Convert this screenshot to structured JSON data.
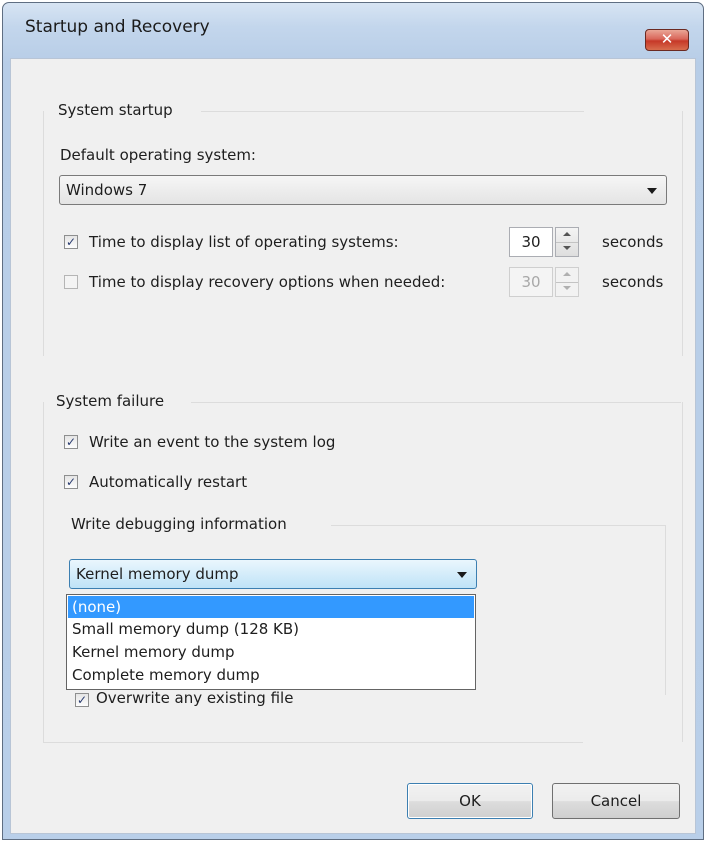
{
  "window": {
    "title": "Startup and Recovery",
    "close_glyph": "✕"
  },
  "system_startup": {
    "group_label": "System startup",
    "default_os_label": "Default operating system:",
    "default_os_value": "Windows 7",
    "list_time": {
      "checked": true,
      "label": "Time to display list of operating systems:",
      "value": "30",
      "unit": "seconds"
    },
    "recovery_time": {
      "checked": false,
      "enabled": false,
      "label": "Time to display recovery options when needed:",
      "value": "30",
      "unit": "seconds"
    }
  },
  "system_failure": {
    "group_label": "System failure",
    "write_event": {
      "checked": true,
      "label": "Write an event to the system log"
    },
    "auto_restart": {
      "checked": true,
      "label": "Automatically restart"
    },
    "debug_group_label": "Write debugging information",
    "debug_selected": "Kernel memory dump",
    "debug_options": [
      "(none)",
      "Small memory dump (128 KB)",
      "Kernel memory dump",
      "Complete memory dump"
    ],
    "highlighted_option": "(none)",
    "overwrite": {
      "checked": true,
      "label": "Overwrite any existing file"
    }
  },
  "buttons": {
    "ok": "OK",
    "cancel": "Cancel"
  },
  "check_glyph": "✓",
  "icons": [
    "close-icon",
    "dropdown-arrow-icon",
    "spin-up-icon",
    "spin-down-icon",
    "checkmark-icon"
  ]
}
